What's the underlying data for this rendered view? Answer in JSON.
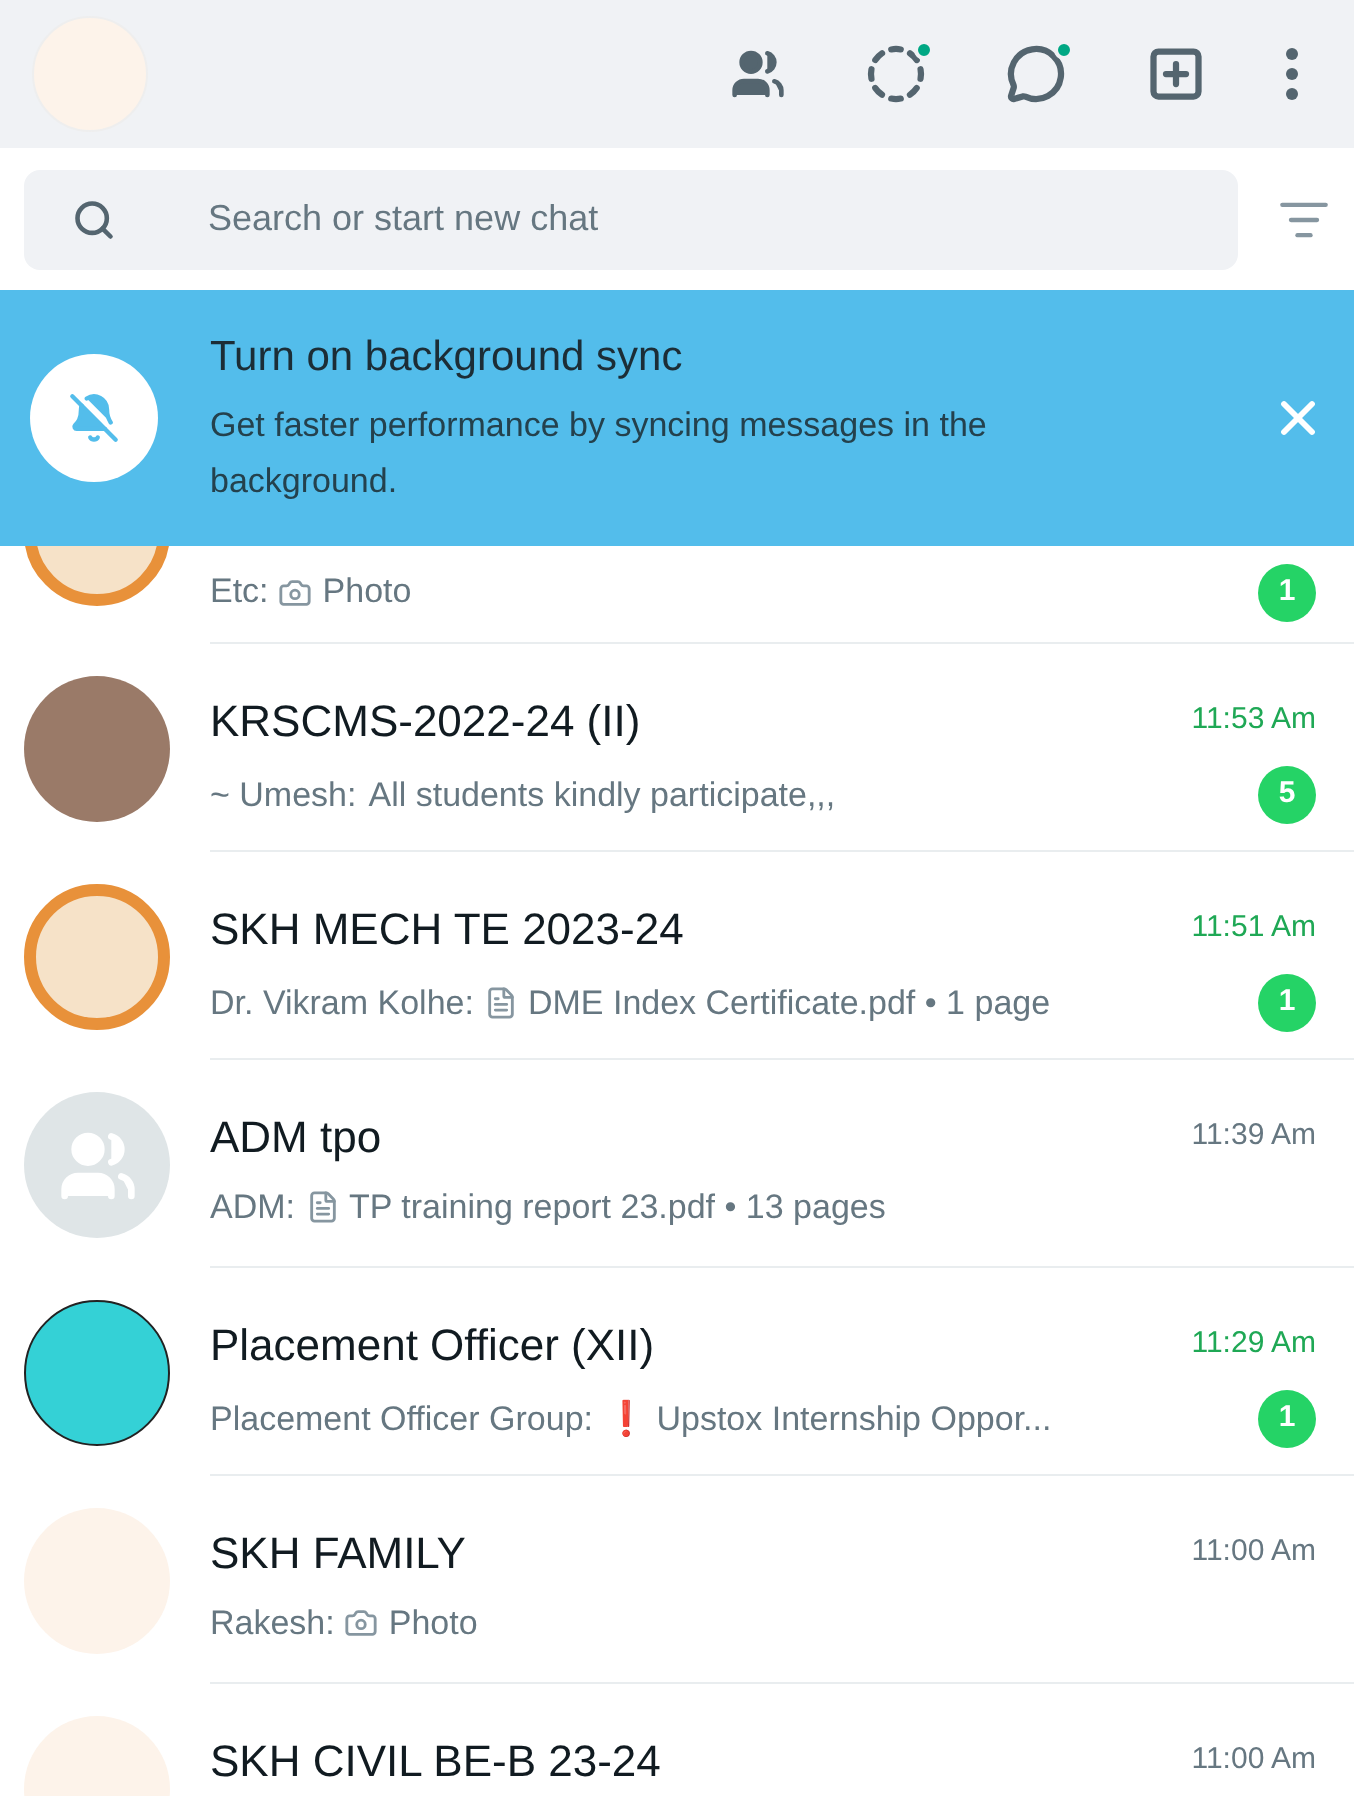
{
  "header": {
    "status_dot": true,
    "channels_dot": true
  },
  "search": {
    "placeholder": "Search or start new chat"
  },
  "banner": {
    "title": "Turn on background sync",
    "body": "Get faster performance by syncing messages in the background."
  },
  "chats": [
    {
      "avatar": {
        "kind": "logo"
      },
      "partial": true,
      "sender": "Etc:",
      "attachment": {
        "kind": "photo"
      },
      "text": "Photo",
      "unread": true,
      "count": "1"
    },
    {
      "avatar": {
        "kind": "photo"
      },
      "name": "KRSCMS-2022-24 (II)",
      "time": "11:53 Am",
      "unread": true,
      "sender": "~ Umesh:",
      "text": "All students kindly participate,,,",
      "count": "5"
    },
    {
      "avatar": {
        "kind": "logo"
      },
      "name": "SKH MECH TE 2023-24",
      "time": "11:51 Am",
      "unread": true,
      "sender": "Dr. Vikram Kolhe:",
      "attachment": {
        "kind": "document"
      },
      "text": "DME Index Certificate.pdf • 1 page",
      "count": "1"
    },
    {
      "avatar": {
        "kind": "group"
      },
      "name": "ADM tpo",
      "time": "11:39 Am",
      "unread": false,
      "sender": "ADM:",
      "attachment": {
        "kind": "document"
      },
      "text": "TP training report 23.pdf • 13 pages"
    },
    {
      "avatar": {
        "kind": "teal"
      },
      "name": "Placement Officer (XII)",
      "time": "11:29 Am",
      "unread": true,
      "sender": "Placement Officer Group:",
      "text": "❗ Upstox Internship Oppor...",
      "count": "1"
    },
    {
      "avatar": {
        "kind": "emblem"
      },
      "name": "SKH FAMILY",
      "time": "11:00 Am",
      "unread": false,
      "sender": "Rakesh:",
      "attachment": {
        "kind": "photo"
      },
      "text": "Photo"
    },
    {
      "avatar": {
        "kind": "emblem"
      },
      "name": "SKH CIVIL BE-B 23-24",
      "time": "11:00 Am",
      "unread": false
    }
  ]
}
